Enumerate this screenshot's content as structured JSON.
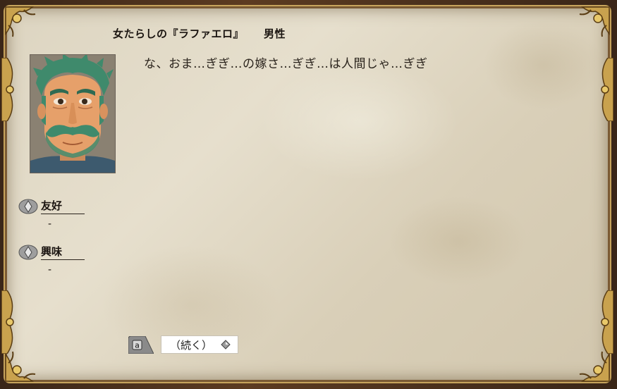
{
  "dialog": {
    "speaker_name": "女たらしの『ラファエロ』",
    "speaker_gender": "男性",
    "message": "な、おま…ぎぎ…の嫁さ…ぎぎ…は人間じゃ…ぎぎ"
  },
  "stats": [
    {
      "label": "友好",
      "value": "-"
    },
    {
      "label": "興味",
      "value": "-"
    }
  ],
  "choices": [
    {
      "key": "a",
      "label": "（続く）"
    }
  ],
  "colors": {
    "parchment": "#e3dbc7",
    "frame_gold": "#c7a45c",
    "frame_dark": "#5c3b21",
    "text": "#1a1410"
  },
  "icons": {
    "stat_bullet": "diamond-bullet-icon",
    "choice_arrow": "diamond-arrow-icon",
    "key_tab": "key-a-icon"
  }
}
